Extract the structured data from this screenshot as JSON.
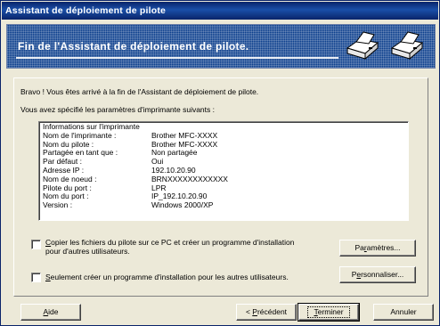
{
  "window": {
    "title": "Assistant de déploiement de pilote"
  },
  "banner": {
    "title": "Fin de l'Assistant de déploiement de pilote.",
    "icons": [
      "printer-icon",
      "printer-icon"
    ]
  },
  "intro": "Bravo ! Vous êtes arrivé à la fin de l'Assistant de déploiement de pilote.",
  "params_intro": "Vous avez spécifié les paramètres d'imprimante suivants :",
  "info": {
    "header": "Informations sur l'imprimante",
    "rows": [
      {
        "label": "Nom de l'imprimante :",
        "value": "Brother MFC-XXXX"
      },
      {
        "label": "Nom du pilote :",
        "value": "Brother MFC-XXXX"
      },
      {
        "label": "Partagée en tant que :",
        "value": "Non partagée"
      },
      {
        "label": "Par défaut :",
        "value": "Oui"
      },
      {
        "label": "Adresse IP :",
        "value": "192.10.20.90"
      },
      {
        "label": "Nom de noeud :",
        "value": "BRNXXXXXXXXXXXX"
      },
      {
        "label": "Pilote du port :",
        "value": "LPR"
      },
      {
        "label": "Nom du port :",
        "value": "IP_192.10.20.90"
      },
      {
        "label": "Version :",
        "value": "Windows 2000/XP"
      }
    ]
  },
  "options": {
    "copy": {
      "pre": "C",
      "rest": "opier les fichiers du pilote sur ce PC et créer un programme d'installation",
      "line2": "pour d'autres utilisateurs.",
      "checked": false
    },
    "only": {
      "pre": "S",
      "rest": "eulement créer un programme d'installation pour les autres utilisateurs.",
      "checked": false
    }
  },
  "buttons": {
    "parametres": {
      "pre": "Pa",
      "u": "r",
      "post": "amètres..."
    },
    "personnaliser": {
      "pre": "P",
      "u": "e",
      "post": "rsonnaliser..."
    },
    "aide": {
      "u": "A",
      "post": "ide"
    },
    "precedent": {
      "pre": "< ",
      "u": "P",
      "post": "récédent"
    },
    "terminer": {
      "u": "T",
      "post": "erminer"
    },
    "annuler": {
      "label": "Annuler"
    }
  }
}
